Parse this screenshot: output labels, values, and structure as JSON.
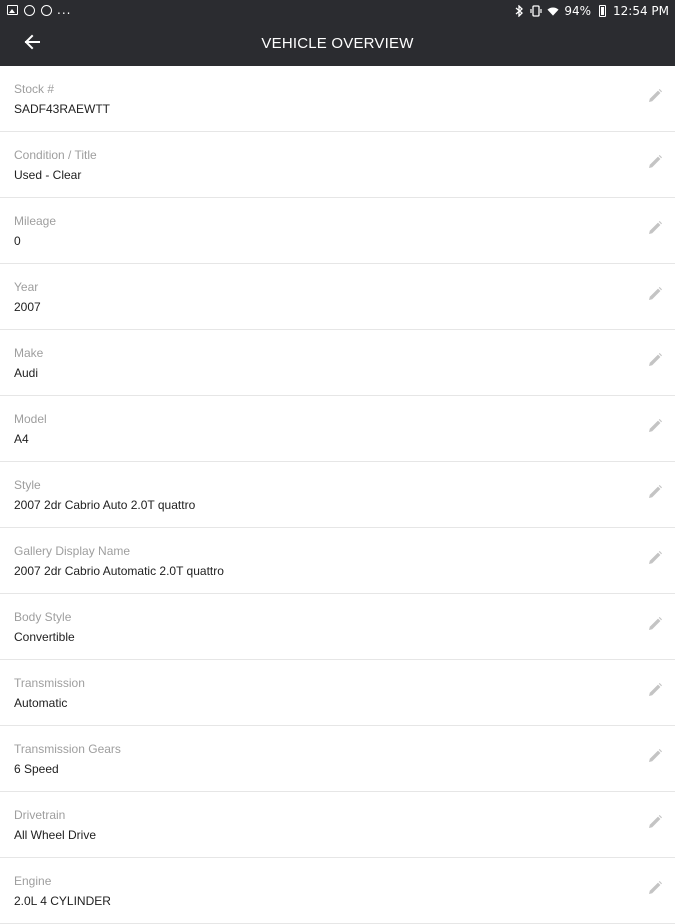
{
  "status_bar": {
    "left_icons": [
      "image-icon",
      "circle-badge-icon",
      "messenger-icon"
    ],
    "more": "...",
    "battery": "94%",
    "time": "12:54 PM"
  },
  "app_bar": {
    "title": "VEHICLE OVERVIEW",
    "back_icon": "arrow-left-icon",
    "background": "#2b2c30"
  },
  "fields": [
    {
      "label": "Stock #",
      "value": "SADF43RAEWTT"
    },
    {
      "label": "Condition / Title",
      "value": "Used - Clear"
    },
    {
      "label": "Mileage",
      "value": "0"
    },
    {
      "label": "Year",
      "value": "2007"
    },
    {
      "label": "Make",
      "value": "Audi"
    },
    {
      "label": "Model",
      "value": "A4"
    },
    {
      "label": "Style",
      "value": "2007 2dr Cabrio Auto 2.0T quattro"
    },
    {
      "label": "Gallery Display Name",
      "value": "2007 2dr Cabrio Automatic 2.0T quattro"
    },
    {
      "label": "Body Style",
      "value": "Convertible"
    },
    {
      "label": "Transmission",
      "value": "Automatic"
    },
    {
      "label": "Transmission Gears",
      "value": "6 Speed"
    },
    {
      "label": "Drivetrain",
      "value": "All Wheel Drive"
    },
    {
      "label": "Engine",
      "value": "2.0L 4 CYLINDER"
    }
  ],
  "edit_icon": "pencil-icon",
  "colors": {
    "label": "#9e9e9e",
    "value": "#212121",
    "divider": "#e6e6e6",
    "edit_icon": "#c4c4c4"
  }
}
